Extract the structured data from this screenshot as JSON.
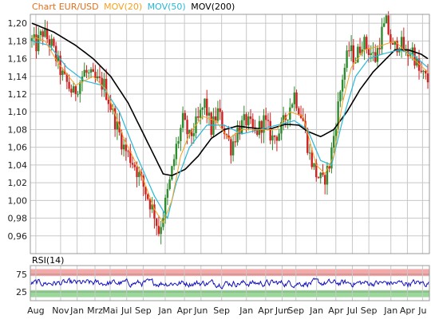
{
  "chart_data": [
    {
      "type": "candlestick",
      "title_parts": [
        {
          "text": "Chart EUR/USD",
          "color": "#e07020"
        },
        {
          "text": "MOV(20)",
          "color": "#f5a020"
        },
        {
          "text": "MOV(50)",
          "color": "#28b8d8"
        },
        {
          "text": "MOV(200)",
          "color": "#000000"
        }
      ],
      "ylim": [
        0.94,
        1.21
      ],
      "yticks": [
        "0,96",
        "0,98",
        "1,00",
        "1,02",
        "1,04",
        "1,06",
        "1,08",
        "1,10",
        "1,12",
        "1,14",
        "1,16",
        "1,18",
        "1,20"
      ],
      "grid": true,
      "price_keypoints": [
        [
          0,
          1.18
        ],
        [
          2,
          1.175
        ],
        [
          5,
          1.19
        ],
        [
          9,
          1.175
        ],
        [
          14,
          1.14
        ],
        [
          19,
          1.12
        ],
        [
          24,
          1.145
        ],
        [
          29,
          1.135
        ],
        [
          33,
          1.13
        ],
        [
          38,
          1.09
        ],
        [
          42,
          1.06
        ],
        [
          47,
          1.04
        ],
        [
          52,
          1.01
        ],
        [
          56,
          0.985
        ],
        [
          58,
          0.965
        ],
        [
          60,
          0.985
        ],
        [
          63,
          1.02
        ],
        [
          66,
          1.06
        ],
        [
          69,
          1.09
        ],
        [
          72,
          1.07
        ],
        [
          76,
          1.09
        ],
        [
          79,
          1.11
        ],
        [
          82,
          1.08
        ],
        [
          85,
          1.1
        ],
        [
          88,
          1.08
        ],
        [
          91,
          1.06
        ],
        [
          94,
          1.08
        ],
        [
          98,
          1.09
        ],
        [
          102,
          1.075
        ],
        [
          106,
          1.09
        ],
        [
          110,
          1.07
        ],
        [
          114,
          1.08
        ],
        [
          117,
          1.1
        ],
        [
          120,
          1.12
        ],
        [
          124,
          1.09
        ],
        [
          127,
          1.05
        ],
        [
          130,
          1.03
        ],
        [
          133,
          1.02
        ],
        [
          136,
          1.04
        ],
        [
          139,
          1.09
        ],
        [
          142,
          1.14
        ],
        [
          145,
          1.17
        ],
        [
          148,
          1.16
        ],
        [
          151,
          1.18
        ],
        [
          154,
          1.17
        ],
        [
          157,
          1.16
        ],
        [
          160,
          1.19
        ],
        [
          162,
          1.2
        ],
        [
          165,
          1.17
        ],
        [
          168,
          1.18
        ],
        [
          171,
          1.165
        ],
        [
          174,
          1.17
        ],
        [
          177,
          1.145
        ],
        [
          179,
          1.14
        ],
        [
          181,
          1.135
        ]
      ],
      "ma20_keypoints": [
        [
          0,
          1.185
        ],
        [
          6,
          1.18
        ],
        [
          12,
          1.155
        ],
        [
          20,
          1.13
        ],
        [
          28,
          1.14
        ],
        [
          34,
          1.125
        ],
        [
          42,
          1.07
        ],
        [
          50,
          1.03
        ],
        [
          56,
          0.99
        ],
        [
          60,
          0.975
        ],
        [
          64,
          1.0
        ],
        [
          68,
          1.05
        ],
        [
          72,
          1.075
        ],
        [
          78,
          1.095
        ],
        [
          84,
          1.09
        ],
        [
          90,
          1.07
        ],
        [
          96,
          1.08
        ],
        [
          104,
          1.08
        ],
        [
          112,
          1.08
        ],
        [
          118,
          1.1
        ],
        [
          124,
          1.095
        ],
        [
          130,
          1.04
        ],
        [
          134,
          1.03
        ],
        [
          138,
          1.05
        ],
        [
          142,
          1.11
        ],
        [
          146,
          1.15
        ],
        [
          152,
          1.17
        ],
        [
          160,
          1.175
        ],
        [
          166,
          1.18
        ],
        [
          172,
          1.165
        ],
        [
          181,
          1.145
        ]
      ],
      "ma50_keypoints": [
        [
          0,
          1.18
        ],
        [
          8,
          1.175
        ],
        [
          16,
          1.15
        ],
        [
          24,
          1.135
        ],
        [
          32,
          1.13
        ],
        [
          40,
          1.1
        ],
        [
          48,
          1.05
        ],
        [
          56,
          1.005
        ],
        [
          62,
          0.98
        ],
        [
          66,
          1.02
        ],
        [
          72,
          1.06
        ],
        [
          80,
          1.085
        ],
        [
          88,
          1.085
        ],
        [
          96,
          1.075
        ],
        [
          104,
          1.08
        ],
        [
          112,
          1.085
        ],
        [
          120,
          1.09
        ],
        [
          126,
          1.08
        ],
        [
          132,
          1.045
        ],
        [
          137,
          1.04
        ],
        [
          142,
          1.09
        ],
        [
          148,
          1.14
        ],
        [
          154,
          1.16
        ],
        [
          160,
          1.165
        ],
        [
          168,
          1.17
        ],
        [
          174,
          1.165
        ],
        [
          181,
          1.15
        ]
      ],
      "ma200_keypoints": [
        [
          0,
          1.2
        ],
        [
          10,
          1.19
        ],
        [
          20,
          1.175
        ],
        [
          28,
          1.16
        ],
        [
          36,
          1.14
        ],
        [
          44,
          1.11
        ],
        [
          50,
          1.08
        ],
        [
          56,
          1.05
        ],
        [
          60,
          1.03
        ],
        [
          64,
          1.028
        ],
        [
          70,
          1.035
        ],
        [
          76,
          1.05
        ],
        [
          82,
          1.07
        ],
        [
          88,
          1.08
        ],
        [
          94,
          1.084
        ],
        [
          100,
          1.082
        ],
        [
          108,
          1.08
        ],
        [
          116,
          1.086
        ],
        [
          122,
          1.085
        ],
        [
          126,
          1.078
        ],
        [
          132,
          1.072
        ],
        [
          138,
          1.08
        ],
        [
          144,
          1.1
        ],
        [
          150,
          1.125
        ],
        [
          156,
          1.145
        ],
        [
          162,
          1.16
        ],
        [
          166,
          1.17
        ],
        [
          172,
          1.17
        ],
        [
          178,
          1.165
        ],
        [
          181,
          1.16
        ]
      ]
    },
    {
      "type": "line",
      "title": "RSI(14)",
      "ylim": [
        0,
        100
      ],
      "yticks": [
        "25",
        "75"
      ],
      "bands": {
        "overbought": [
          70,
          90
        ],
        "oversold": [
          10,
          30
        ],
        "upper_color": "#f4a8a8",
        "lower_color": "#9ad89a"
      },
      "series_color": "#1010c0",
      "rsi_mean": 50,
      "rsi_spread": 18
    }
  ],
  "x_axis": {
    "labels": [
      "Aug",
      "Nov",
      "Jan",
      "Mrz",
      "Mai",
      "Jul",
      "Sep",
      "Jan",
      "Apr",
      "Jun",
      "Sep",
      "Jan",
      "Apr",
      "Jun",
      "Sep",
      "Jan",
      "Apr",
      "Jul",
      "Sep",
      "Jan",
      "Apr",
      "Ju"
    ],
    "positions": [
      0.02,
      0.11,
      0.17,
      0.235,
      0.29,
      0.35,
      0.41,
      0.49,
      0.56,
      0.62,
      0.695,
      0.785,
      0.855,
      0.915,
      0.965,
      1.04,
      1.11,
      1.17,
      1.23,
      1.31,
      1.37,
      1.425
    ]
  },
  "colors": {
    "candle_up": "#2e8b2e",
    "candle_down": "#d02020",
    "grid": "#c8c8c8",
    "plot_bg": "#ffffff",
    "frame": "#999999"
  }
}
